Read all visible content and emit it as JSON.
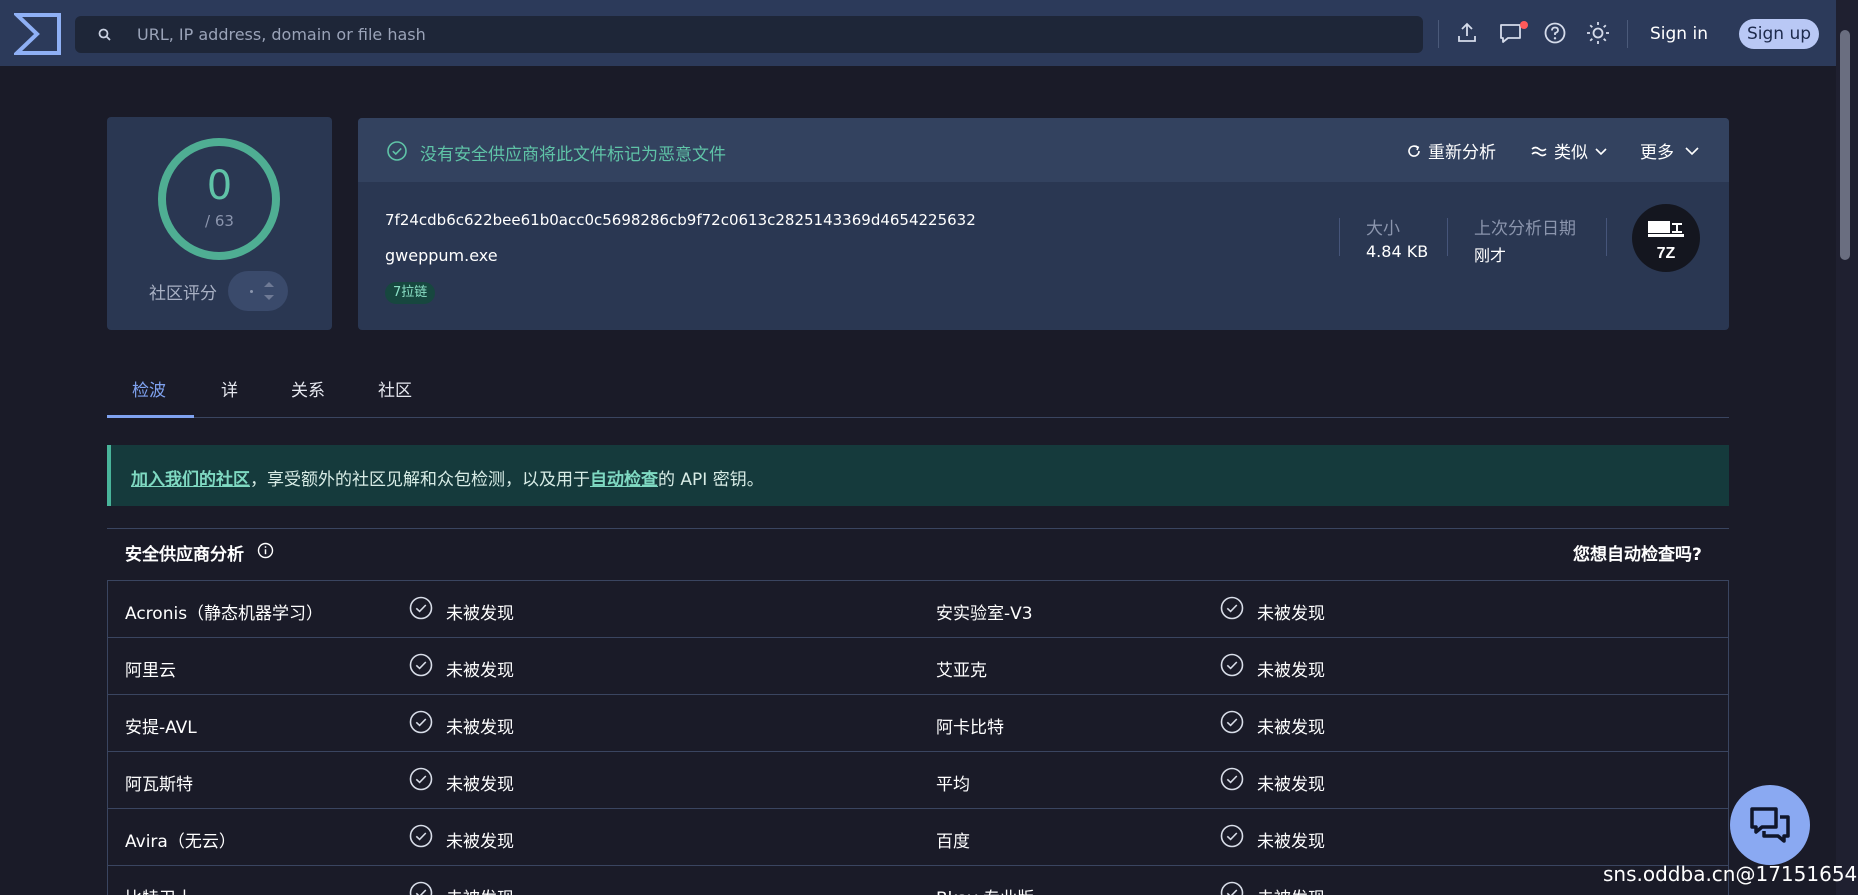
{
  "search": {
    "placeholder": "URL, IP address, domain or file hash"
  },
  "header": {
    "signin": "Sign in",
    "signup": "Sign up"
  },
  "score": {
    "detections": "0",
    "total": "/ 63",
    "community_label": "社区评分"
  },
  "file": {
    "verdict": "没有安全供应商将此文件标记为恶意文件",
    "actions": {
      "reanalyze": "重新分析",
      "similar": "类似",
      "more": "更多"
    },
    "hash": "7f24cdb6c622bee61b0acc0c5698286cb9f72c0613c2825143369d4654225632",
    "name": "gweppum.exe",
    "tag": "7拉链",
    "size_label": "大小",
    "size_value": "4.84 KB",
    "date_label": "上次分析日期",
    "date_value": "刚才",
    "type_badge": "7Z"
  },
  "tabs": [
    {
      "label": "检波"
    },
    {
      "label": "详"
    },
    {
      "label": "关系"
    },
    {
      "label": "社区"
    }
  ],
  "banner": {
    "link1": "加入我们的社区",
    "text1": "，享受额外的社区见解和众包检测，以及用于",
    "link2": "自动检查",
    "text2": "的 API 密钥。"
  },
  "vendors": {
    "title": "安全供应商分析",
    "right_link": "您想自动检查吗?",
    "rows": [
      {
        "left": "Acronis（静态机器学习）",
        "left_status": "未被发现",
        "right": "安实验室-V3",
        "right_status": "未被发现"
      },
      {
        "left": "阿里云",
        "left_status": "未被发现",
        "right": "艾亚克",
        "right_status": "未被发现"
      },
      {
        "left": "安提-AVL",
        "left_status": "未被发现",
        "right": "阿卡比特",
        "right_status": "未被发现"
      },
      {
        "left": "阿瓦斯特",
        "left_status": "未被发现",
        "right": "平均",
        "right_status": "未被发现"
      },
      {
        "left": "Avira（无云）",
        "left_status": "未被发现",
        "right": "百度",
        "right_status": "未被发现"
      },
      {
        "left": "比特卫士",
        "left_status": "未被发现",
        "right": "Bkav 专业版",
        "right_status": "未被发现"
      }
    ]
  },
  "watermark": "sns.oddba.cn@17151654",
  "colors": {
    "accent": "#7fa2f0",
    "clean": "#5fc3a7",
    "topbar": "#2c3a5a",
    "background": "#1a1b28"
  }
}
